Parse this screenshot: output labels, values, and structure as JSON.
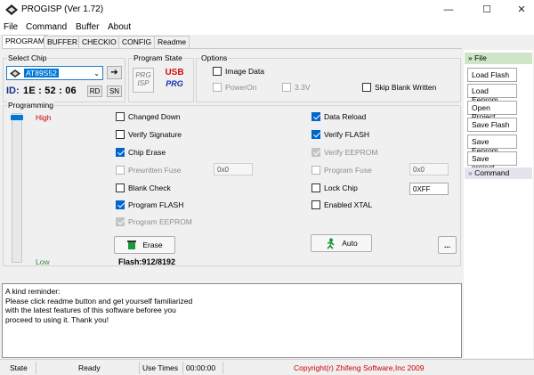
{
  "window": {
    "title": "PROGISP (Ver 1.72)",
    "minimize": "—",
    "maximize": "☐",
    "close": "✕"
  },
  "menu": [
    "File",
    "Command",
    "Buffer",
    "About"
  ],
  "tabs": [
    "PROGRAM",
    "BUFFER",
    "CHECKIO",
    "CONFIG",
    "Readme"
  ],
  "select_chip": {
    "label": "Select Chip",
    "value": "AT89S52",
    "go_icon": "➔",
    "id_label": "ID:",
    "id_value": "1E : 52 : 06",
    "rd": "RD",
    "sn": "SN"
  },
  "program_state": {
    "label": "Program State",
    "logo1_top": "PRG",
    "logo1_bottom": "ISP",
    "logo2_top": "USB",
    "logo2_bottom": "PRG"
  },
  "options": {
    "label": "Options",
    "image_data": "Image Data",
    "power_on": "PowerOn",
    "voltage": "3.3V",
    "skip_blank": "Skip Blank Written"
  },
  "programming": {
    "label": "Programming",
    "high": "High",
    "low": "Low",
    "level_pct": 100,
    "left": [
      {
        "label": "Changed Down",
        "checked": false,
        "disabled": false
      },
      {
        "label": "Verify Signature",
        "checked": false,
        "disabled": false
      },
      {
        "label": "Chip Erase",
        "checked": true,
        "disabled": false
      },
      {
        "label": "Prewritten Fuse",
        "checked": false,
        "disabled": true
      },
      {
        "label": "Blank Check",
        "checked": false,
        "disabled": false
      },
      {
        "label": "Program FLASH",
        "checked": true,
        "disabled": false
      },
      {
        "label": "Program EEPROM",
        "checked": true,
        "disabled": true
      }
    ],
    "right": [
      {
        "label": "Data Reload",
        "checked": true,
        "disabled": false
      },
      {
        "label": "Verify FLASH",
        "checked": true,
        "disabled": false
      },
      {
        "label": "Verify EEPROM",
        "checked": true,
        "disabled": true
      },
      {
        "label": "Program Fuse",
        "checked": false,
        "disabled": true
      },
      {
        "label": "Lock Chip",
        "checked": false,
        "disabled": false
      },
      {
        "label": "Enabled XTAL",
        "checked": false,
        "disabled": false
      }
    ],
    "prewritten_fuse_value": "0x0",
    "program_fuse_value": "0x0",
    "lock_chip_value": "0XFF",
    "erase_label": "Erase",
    "auto_label": "Auto",
    "more_label": "...",
    "flash_info": "Flash:912/8192"
  },
  "sidebar": {
    "file_head": "File",
    "buttons": [
      "Load Flash",
      "Load Eeprom",
      "Open Project",
      "Save Flash",
      "Save Eeprom",
      "Save project"
    ],
    "command_head": "Command"
  },
  "message": "A kind reminder:\nPlease click readme button and get yourself familiarized\nwith the latest features of this software beforee you\nproceed to using it. Thank you!",
  "status": {
    "state_label": "State",
    "state_value": "Ready",
    "use_times_label": "Use Times",
    "use_times_value": "00:00:00",
    "copyright": "Copyright(r) Zhifeng Software,Inc 2009"
  },
  "colors": {
    "accent": "#0078d7",
    "high": "#cc0000",
    "low": "#3a8a3a",
    "copyright": "#d00000",
    "sidebar_head": "#cfe5c8"
  }
}
